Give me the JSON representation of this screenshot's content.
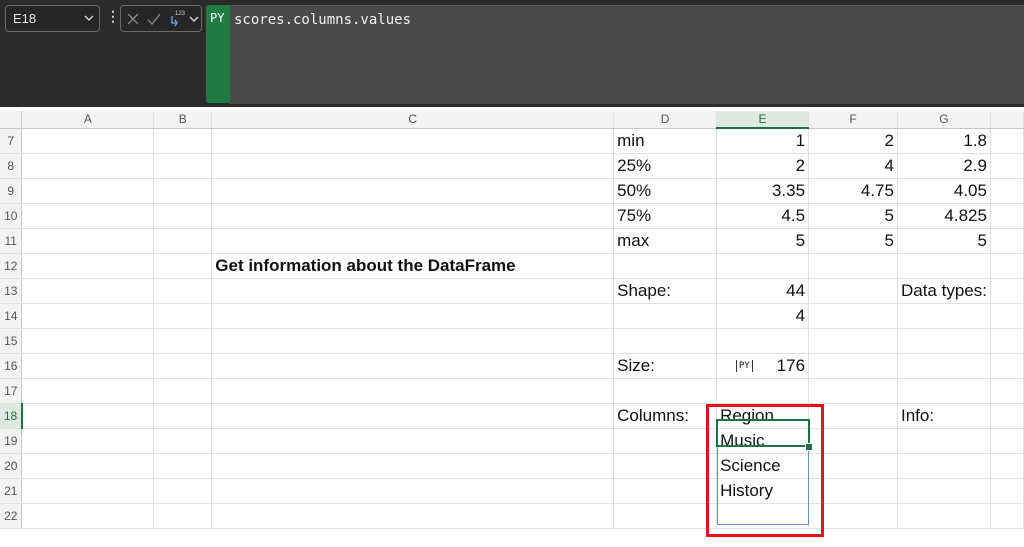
{
  "name_box": {
    "cell_ref": "E18"
  },
  "formula_bar": {
    "fx_icons": [
      "cancel-icon",
      "enter-icon",
      "python-output-icon"
    ],
    "python_badge": "PY",
    "formula": "scores.columns.values"
  },
  "columns": [
    "A",
    "B",
    "C",
    "D",
    "E",
    "F",
    "G"
  ],
  "selected_column": "E",
  "selected_row": "18",
  "rows": [
    {
      "n": "7",
      "C": "",
      "D": "min",
      "E": "1",
      "F": "2",
      "G": "1.8"
    },
    {
      "n": "8",
      "C": "",
      "D": "25%",
      "E": "2",
      "F": "4",
      "G": "2.9"
    },
    {
      "n": "9",
      "C": "",
      "D": "50%",
      "E": "3.35",
      "F": "4.75",
      "G": "4.05"
    },
    {
      "n": "10",
      "C": "",
      "D": "75%",
      "E": "4.5",
      "F": "5",
      "G": "4.825"
    },
    {
      "n": "11",
      "C": "",
      "D": "max",
      "E": "5",
      "F": "5",
      "G": "5"
    },
    {
      "n": "12",
      "C": "Get information about the DataFrame",
      "D": "",
      "E": "",
      "F": "",
      "G": ""
    },
    {
      "n": "13",
      "C": "",
      "D": "Shape:",
      "E": "44",
      "F": "",
      "G": "Data types:"
    },
    {
      "n": "14",
      "C": "",
      "D": "",
      "E": "4",
      "F": "",
      "G": ""
    },
    {
      "n": "15",
      "C": "",
      "D": "",
      "E": "",
      "F": "",
      "G": ""
    },
    {
      "n": "16",
      "C": "",
      "D": "Size:",
      "E": "176",
      "F": "",
      "G": ""
    },
    {
      "n": "17",
      "C": "",
      "D": "",
      "E": "",
      "F": "",
      "G": ""
    },
    {
      "n": "18",
      "C": "",
      "D": "Columns:",
      "E": "Region",
      "F": "",
      "G": "Info:"
    },
    {
      "n": "19",
      "C": "",
      "D": "",
      "E": "Music",
      "F": "",
      "G": ""
    },
    {
      "n": "20",
      "C": "",
      "D": "",
      "E": "Science",
      "F": "",
      "G": ""
    },
    {
      "n": "21",
      "C": "",
      "D": "",
      "E": "History",
      "F": "",
      "G": ""
    },
    {
      "n": "22",
      "C": "",
      "D": "",
      "E": "",
      "F": "",
      "G": ""
    }
  ],
  "python_cell_marker": "PY",
  "colors": {
    "highlight": "#e8101b",
    "selection": "#1e7145",
    "python_green": "#1f7a43",
    "spill_border": "#6a8fd0"
  }
}
